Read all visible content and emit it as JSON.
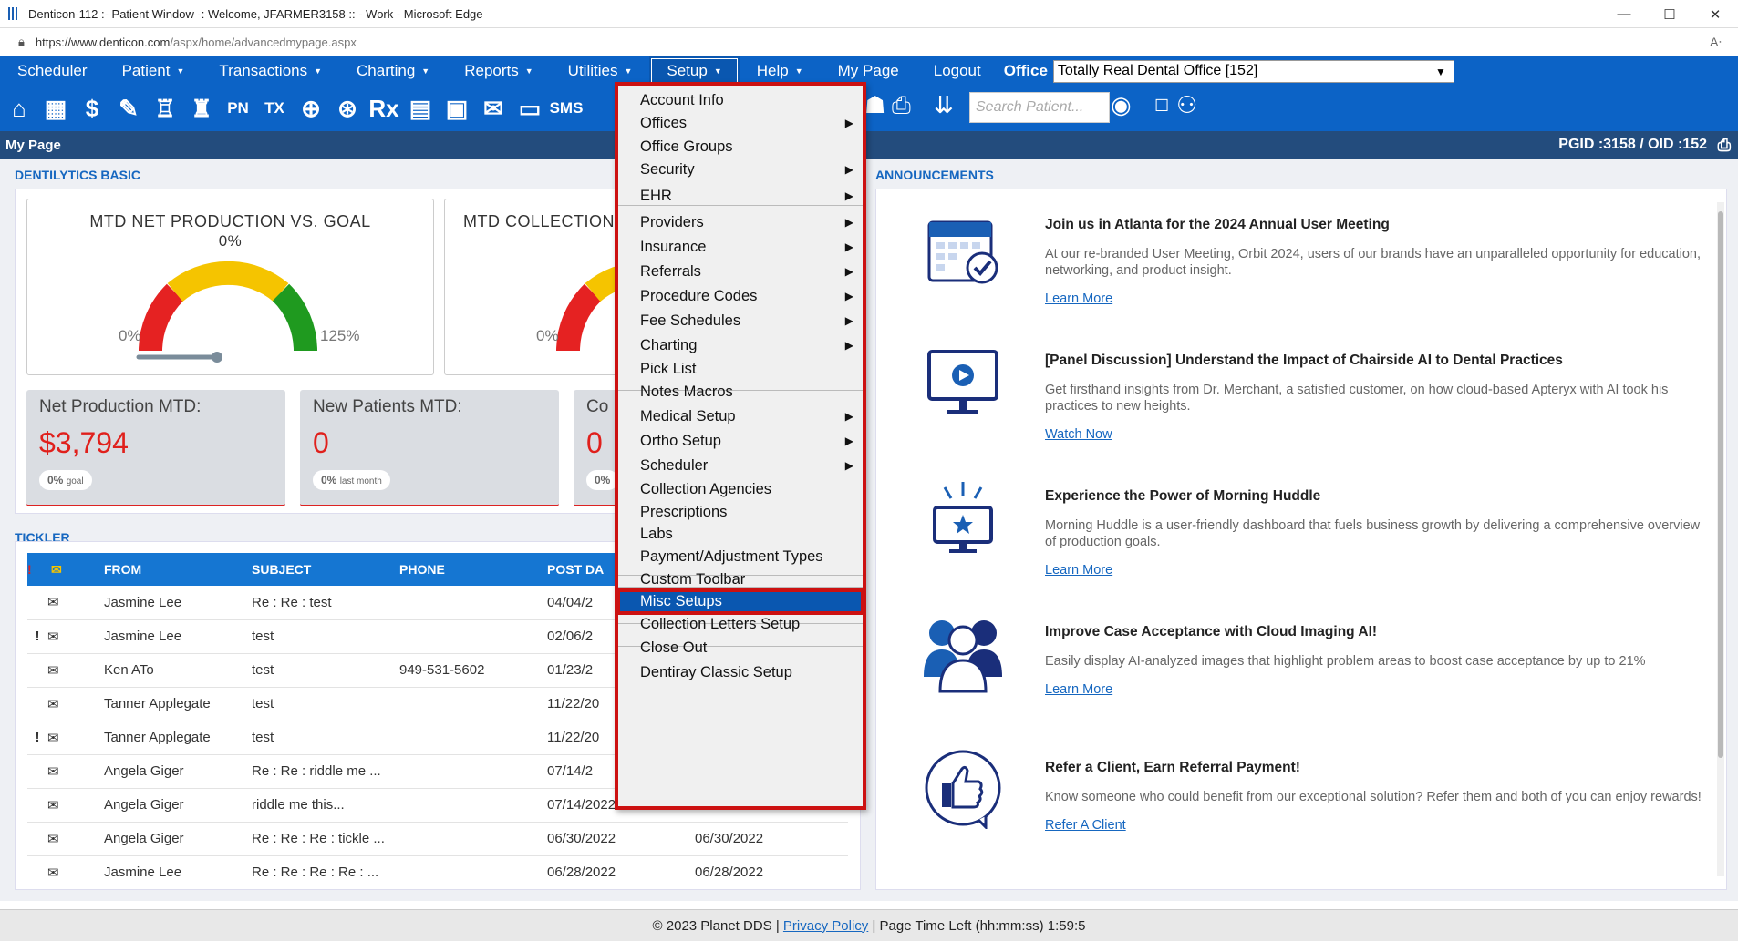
{
  "window": {
    "title": "Denticon-112 :- Patient Window -: Welcome, JFARMER3158 :: - Work - Microsoft Edge",
    "minimize": "—",
    "maximize": "☐",
    "close": "✕"
  },
  "address": {
    "url_host": "https://www.denticon.com",
    "url_path": "/aspx/home/advancedmypage.aspx"
  },
  "menu": {
    "items": [
      {
        "label": "Scheduler",
        "caret": false
      },
      {
        "label": "Patient",
        "caret": true
      },
      {
        "label": "Transactions",
        "caret": true
      },
      {
        "label": "Charting",
        "caret": true
      },
      {
        "label": "Reports",
        "caret": true
      },
      {
        "label": "Utilities",
        "caret": true
      },
      {
        "label": "Setup",
        "caret": true,
        "active": true
      },
      {
        "label": "Help",
        "caret": true
      },
      {
        "label": "My Page",
        "caret": false
      },
      {
        "label": "Logout",
        "caret": false
      }
    ],
    "office_label": "Office",
    "office_value": "Totally Real Dental Office [152]"
  },
  "toolbar": {
    "search_placeholder": "Search Patient...",
    "badge": "0",
    "sms": "SMS",
    "pn": "PN",
    "tx": "TX",
    "rx": "Rx"
  },
  "pagebar": {
    "title": "My Page",
    "ids": "PGID :3158 / OID :152"
  },
  "dentilytics": {
    "header": "DENTILYTICS BASIC",
    "gauge1": {
      "title": "MTD NET PRODUCTION VS. GOAL",
      "pct": "0%",
      "min": "0%",
      "max": "125%"
    },
    "gauge2": {
      "title": "MTD COLLECTION",
      "min": "0%"
    },
    "stats": [
      {
        "label": "Net Production MTD:",
        "value": "$3,794",
        "pill_pct": "0%",
        "pill_txt": "goal"
      },
      {
        "label": "New Patients MTD:",
        "value": "0",
        "pill_pct": "0%",
        "pill_txt": "last month"
      },
      {
        "label": "Co",
        "value": "0",
        "pill_pct": "0%",
        "pill_txt": ""
      }
    ]
  },
  "tickler": {
    "header": "TICKLER",
    "columns": {
      "from": "FROM",
      "subject": "SUBJECT",
      "phone": "PHONE",
      "post": "POST DA"
    },
    "rows": [
      {
        "flag": "",
        "from": "Jasmine Lee",
        "subject": "Re : Re : test",
        "phone": "",
        "post": "04/04/2",
        "due": ""
      },
      {
        "flag": "!",
        "from": "Jasmine Lee",
        "subject": "test",
        "phone": "",
        "post": "02/06/2",
        "due": ""
      },
      {
        "flag": "",
        "from": "Ken ATo",
        "subject": "test",
        "phone": "949-531-5602",
        "post": "01/23/2",
        "due": ""
      },
      {
        "flag": "",
        "from": "Tanner Applegate",
        "subject": "test",
        "phone": "",
        "post": "11/22/20",
        "due": ""
      },
      {
        "flag": "!",
        "from": "Tanner Applegate",
        "subject": "test",
        "phone": "",
        "post": "11/22/20",
        "due": ""
      },
      {
        "flag": "",
        "from": "Angela Giger",
        "subject": "Re : Re : riddle me ...",
        "phone": "",
        "post": "07/14/2",
        "due": ""
      },
      {
        "flag": "",
        "from": "Angela Giger",
        "subject": "riddle me this...",
        "phone": "",
        "post": "07/14/2022",
        "due": "07/14/2022"
      },
      {
        "flag": "",
        "from": "Angela Giger",
        "subject": "Re : Re : Re : tickle ...",
        "phone": "",
        "post": "06/30/2022",
        "due": "06/30/2022"
      },
      {
        "flag": "",
        "from": "Jasmine Lee",
        "subject": "Re : Re : Re : Re : ...",
        "phone": "",
        "post": "06/28/2022",
        "due": "06/28/2022"
      }
    ]
  },
  "announcements": {
    "header": "ANNOUNCEMENTS",
    "items": [
      {
        "title": "Join us in Atlanta for the 2024 Annual User Meeting",
        "body": "At our re-branded User Meeting, Orbit 2024, users of our brands have an unparalleled opportunity for education, networking, and product insight.",
        "link": "Learn More"
      },
      {
        "title": "[Panel Discussion] Understand the Impact of Chairside AI to Dental Practices",
        "body": "Get firsthand insights from Dr. Merchant, a satisfied customer, on how cloud-based Apteryx with AI took his practices to new heights.",
        "link": "Watch Now"
      },
      {
        "title": "Experience the Power of Morning Huddle",
        "body": "Morning Huddle is a user-friendly dashboard that fuels business growth by delivering a comprehensive overview of production goals.",
        "link": "Learn More"
      },
      {
        "title": "Improve Case Acceptance with Cloud Imaging AI!",
        "body": "Easily display AI-analyzed images that highlight problem areas to boost case acceptance by up to 21%",
        "link": "Learn More"
      },
      {
        "title": "Refer a Client, Earn Referral Payment!",
        "body": "Know someone who could benefit from our exceptional solution? Refer them and both of you can enjoy rewards!",
        "link": "Refer A Client"
      }
    ]
  },
  "setup_menu": {
    "items": [
      {
        "label": "Account Info",
        "sub": false
      },
      {
        "label": "Offices",
        "sub": true
      },
      {
        "label": "Office Groups",
        "sub": false
      },
      {
        "label": "Security",
        "sub": true
      },
      {
        "label": "EHR",
        "sub": true
      },
      {
        "label": "Providers",
        "sub": true
      },
      {
        "label": "Insurance",
        "sub": true
      },
      {
        "label": "Referrals",
        "sub": true
      },
      {
        "label": "Procedure Codes",
        "sub": true
      },
      {
        "label": "Fee Schedules",
        "sub": true
      },
      {
        "label": "Charting",
        "sub": true
      },
      {
        "label": "Pick List",
        "sub": false
      },
      {
        "label": "Notes Macros",
        "sub": false
      },
      {
        "label": "Medical Setup",
        "sub": true
      },
      {
        "label": "Ortho Setup",
        "sub": true
      },
      {
        "label": "Scheduler",
        "sub": true
      },
      {
        "label": "Collection Agencies",
        "sub": false
      },
      {
        "label": "Prescriptions",
        "sub": false
      },
      {
        "label": "Labs",
        "sub": false
      },
      {
        "label": "Payment/Adjustment Types",
        "sub": false
      },
      {
        "label": "Custom Toolbar",
        "sub": false
      },
      {
        "label": "Misc Setups",
        "sub": false,
        "highlight": true
      },
      {
        "label": "Collection Letters Setup",
        "sub": false
      },
      {
        "label": "Close Out",
        "sub": false
      },
      {
        "label": "Dentiray Classic Setup",
        "sub": false
      }
    ]
  },
  "footer": {
    "copyright": "© 2023 Planet DDS |",
    "privacy": "Privacy Policy",
    "timeleft": "| Page Time Left (hh:mm:ss) 1:59:5"
  }
}
